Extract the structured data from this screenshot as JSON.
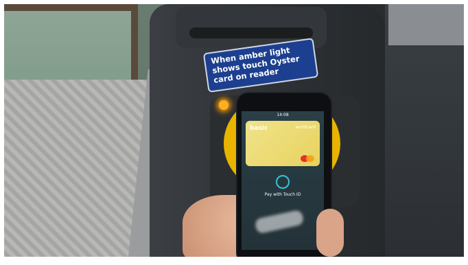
{
  "sign": {
    "line1": "When amber light",
    "line2": "shows touch Oyster",
    "line3": "card on reader"
  },
  "phone": {
    "time": "14:08",
    "card_brand": "basic",
    "card_network": "worldcard",
    "prompt": "Pay with Touch ID"
  },
  "colors": {
    "sign_blue": "#1d3f8f",
    "reader_yellow": "#e8b400",
    "amber_light": "#ffb020"
  },
  "icons": [
    "fingerprint-icon",
    "mastercard-logo-icon"
  ]
}
